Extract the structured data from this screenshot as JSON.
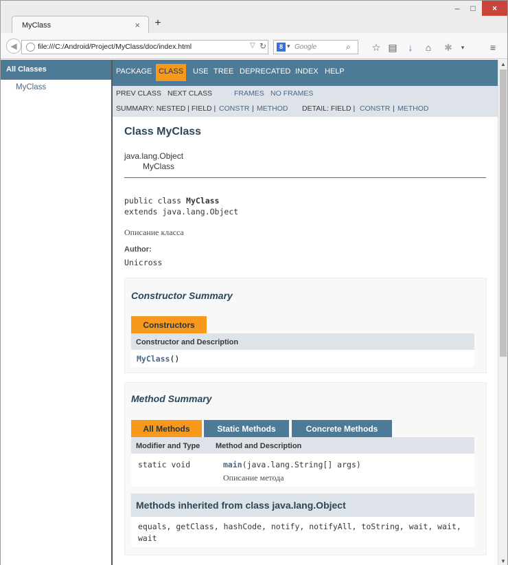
{
  "browser": {
    "tab_title": "MyClass",
    "tab_close": "×",
    "new_tab": "+",
    "minimize": "–",
    "maximize": "□",
    "close": "×",
    "url": "file:///C:/Android/Project/MyClass/doc/index.html",
    "search_engine_badge": "8",
    "search_placeholder": "Google",
    "icons": [
      "back-arrow",
      "globe",
      "dropdown-arrow",
      "reload",
      "magnifier",
      "star",
      "reading-list",
      "download",
      "home",
      "extension",
      "menu"
    ]
  },
  "left_frame": {
    "header": "All Classes",
    "classes": [
      "MyClass"
    ]
  },
  "top_nav": {
    "items": [
      "PACKAGE",
      "CLASS",
      "USE",
      "TREE",
      "DEPRECATED",
      "INDEX",
      "HELP"
    ],
    "active": "CLASS"
  },
  "sub_nav": {
    "prev_class": "PREV CLASS",
    "next_class": "NEXT CLASS",
    "frames": "FRAMES",
    "no_frames": "NO FRAMES",
    "summary_label": "SUMMARY: NESTED | FIELD |",
    "summary_constr": "CONSTR",
    "summary_sep": "|",
    "summary_method": "METHOD",
    "detail_label": "DETAIL: FIELD |",
    "detail_constr": "CONSTR",
    "detail_sep": "|",
    "detail_method": "METHOD"
  },
  "class_page": {
    "title": "Class MyClass",
    "inheritance": [
      "java.lang.Object",
      "MyClass"
    ],
    "declaration_prefix": "public class ",
    "declaration_name": "MyClass",
    "declaration_extends": "extends java.lang.Object",
    "description": "Описание класса",
    "author_label": "Author:",
    "author": "Unicross"
  },
  "constructor_summary": {
    "title": "Constructor Summary",
    "tab": "Constructors",
    "header": "Constructor and Description",
    "rows": [
      {
        "name": "MyClass",
        "params": "()"
      }
    ]
  },
  "method_summary": {
    "title": "Method Summary",
    "tabs": [
      "All Methods",
      "Static Methods",
      "Concrete Methods"
    ],
    "active_tab": "All Methods",
    "headers": [
      "Modifier and Type",
      "Method and Description"
    ],
    "rows": [
      {
        "type": "static void",
        "name": "main",
        "signature": "(java.lang.String[] args)",
        "description": "Описание метода"
      }
    ],
    "inherited_title": "Methods inherited from class java.lang.Object",
    "inherited_methods": "equals, getClass, hashCode, notify, notifyAll, toString, wait, wait, wait"
  },
  "colors": {
    "nav_blue": "#4d7a97",
    "accent_orange": "#f8981d",
    "subnav_gray": "#dee3e9",
    "title_dark": "#2c4557"
  }
}
